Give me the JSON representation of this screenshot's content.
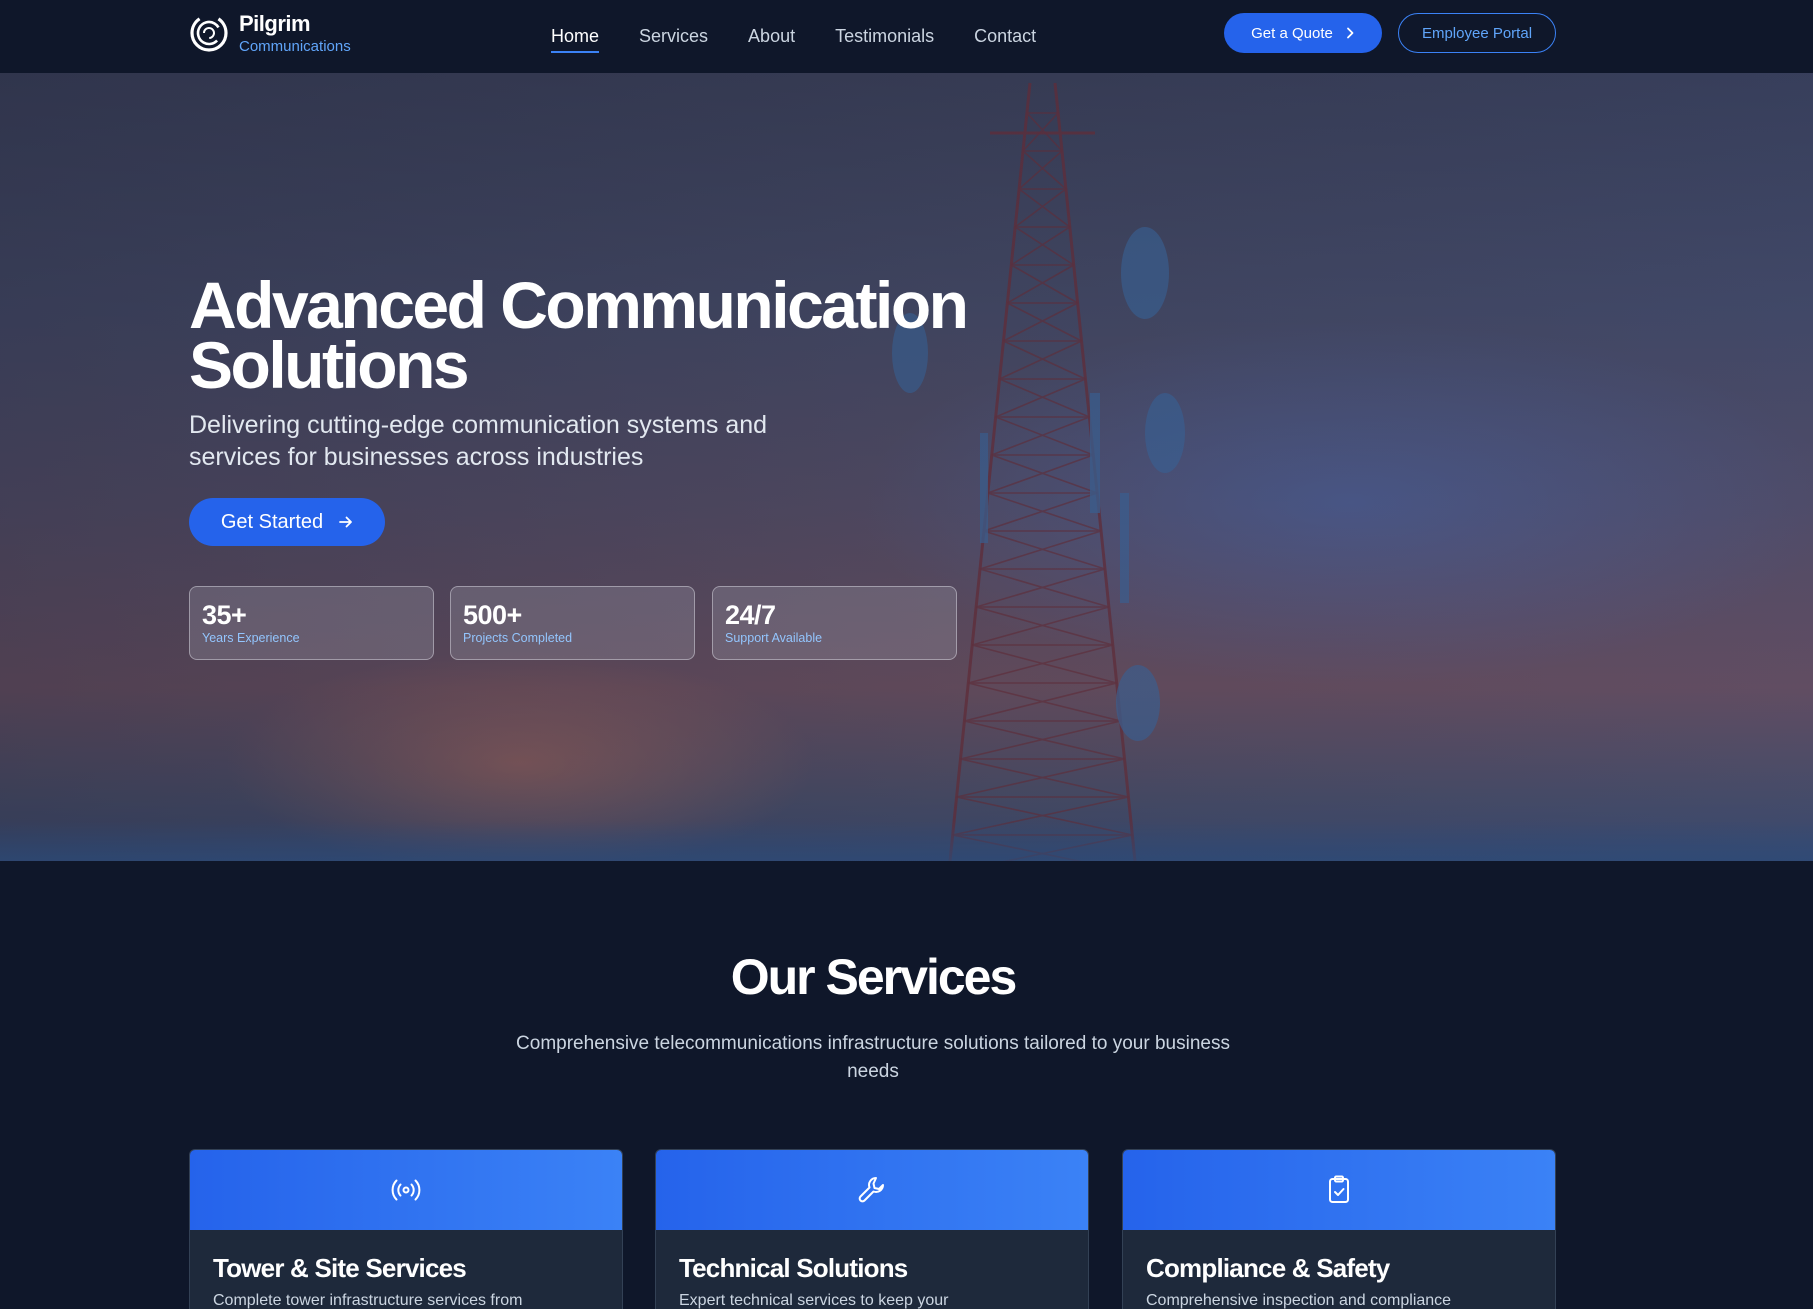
{
  "brand": {
    "name": "Pilgrim",
    "subtitle": "Communications"
  },
  "nav": {
    "links": [
      "Home",
      "Services",
      "About",
      "Testimonials",
      "Contact"
    ],
    "active": "Home",
    "quote_button": "Get a Quote",
    "portal_button": "Employee Portal"
  },
  "hero": {
    "title": "Advanced Communication Solutions",
    "subtitle": "Delivering cutting-edge communication systems and services for businesses across industries",
    "cta": "Get Started",
    "stats": [
      {
        "value": "35+",
        "label": "Years Experience"
      },
      {
        "value": "500+",
        "label": "Projects Completed"
      },
      {
        "value": "24/7",
        "label": "Support Available"
      }
    ]
  },
  "services": {
    "title": "Our Services",
    "description": "Comprehensive telecommunications infrastructure solutions tailored to your business needs",
    "cards": [
      {
        "icon": "radio-signal-icon",
        "title": "Tower & Site Services",
        "text": "Complete tower infrastructure services from"
      },
      {
        "icon": "wrench-icon",
        "title": "Technical Solutions",
        "text": "Expert technical services to keep your"
      },
      {
        "icon": "clipboard-check-icon",
        "title": "Compliance & Safety",
        "text": "Comprehensive inspection and compliance"
      }
    ]
  },
  "colors": {
    "background": "#0f172a",
    "accent": "#2563eb",
    "accent_light": "#60a5fa",
    "card": "#1e293b"
  }
}
